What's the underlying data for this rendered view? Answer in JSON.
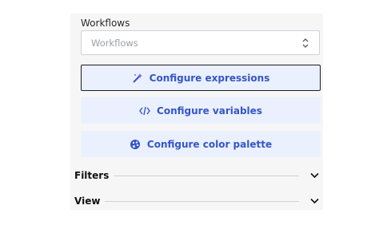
{
  "workflows": {
    "label": "Workflows",
    "selected": "Workflows"
  },
  "buttons": {
    "expressions": "Configure expressions",
    "variables": "Configure variables",
    "palette": "Configure color palette"
  },
  "sections": {
    "filters": "Filters",
    "view": "View"
  },
  "colors": {
    "accent": "#3556c8",
    "button_bg": "#eaf0fe",
    "panel_bg": "#f6f6f7"
  },
  "icons": {
    "expressions": "magic-wand-icon",
    "variables": "code-icon",
    "palette": "palette-icon",
    "select": "updown-chevron-icon",
    "collapse": "chevron-down-icon"
  }
}
